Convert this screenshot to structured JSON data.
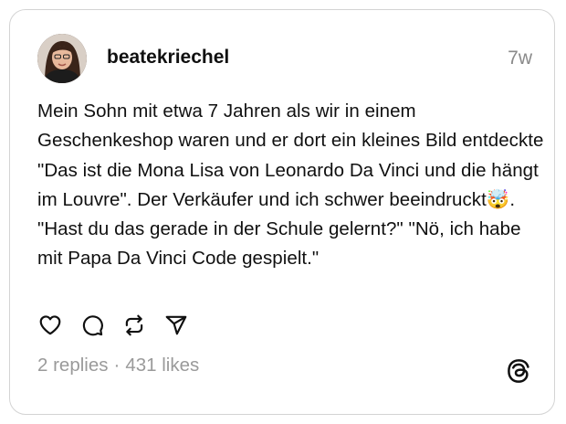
{
  "post": {
    "username": "beatekriechel",
    "timestamp": "7w",
    "text": "Mein Sohn mit etwa 7 Jahren als wir in einem Geschenkeshop waren und er dort ein kleines Bild entdeckte \"Das ist die Mona Lisa von Leonardo Da Vinci und die hängt im Louvre\". Der Verkäufer und ich schwer beeindruckt🤯. \"Hast du das gerade in der Schule gelernt?\" \"Nö, ich habe mit Papa Da Vinci Code gespielt.\"",
    "replies": "2 replies",
    "separator": "·",
    "likes": "431 likes"
  },
  "icons": {
    "like": "heart-icon",
    "reply": "comment-icon",
    "repost": "repost-icon",
    "share": "send-icon",
    "brand": "threads-logo-icon"
  }
}
